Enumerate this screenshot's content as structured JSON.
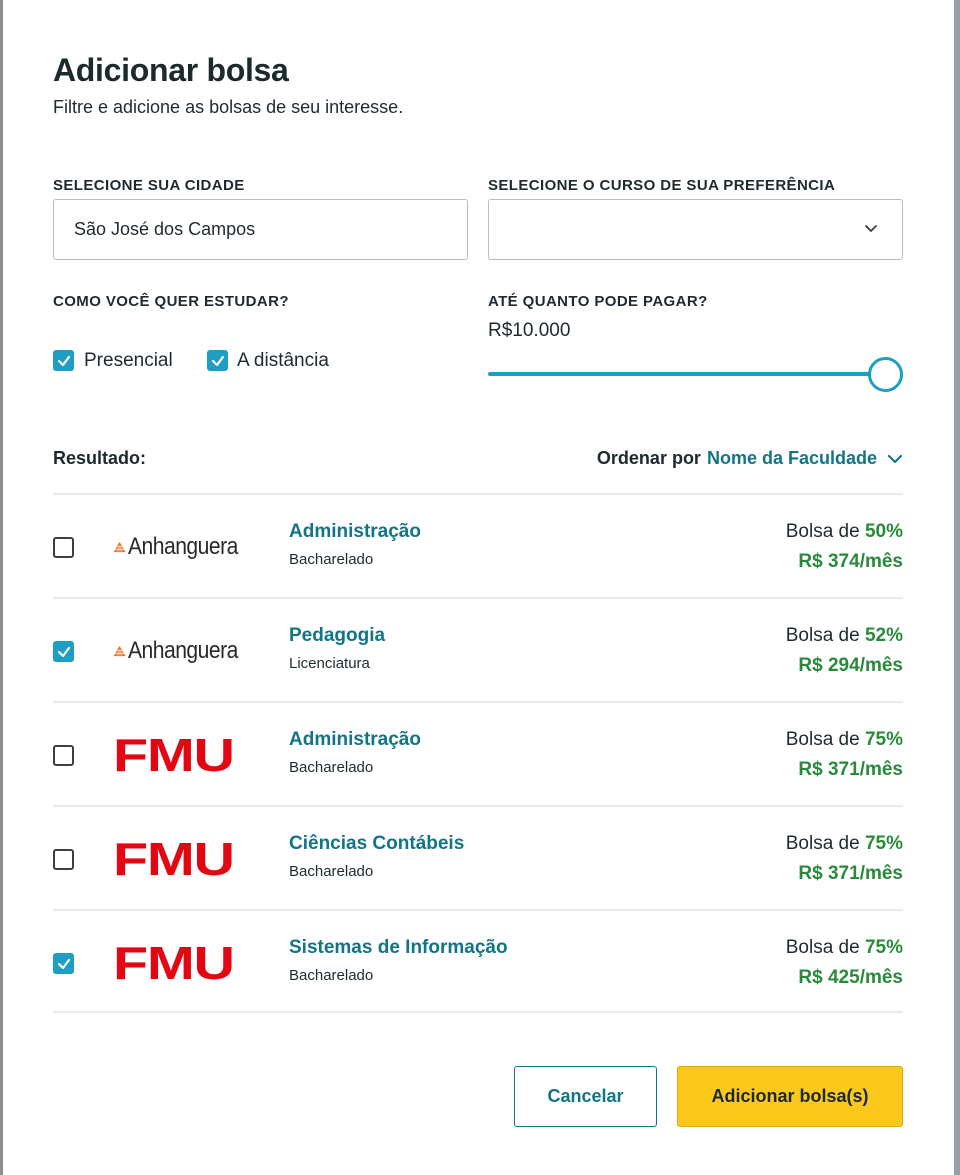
{
  "dialog": {
    "title": "Adicionar bolsa",
    "subtitle": "Filtre e adicione as bolsas de seu interesse."
  },
  "filters": {
    "city_label": "SELECIONE SUA CIDADE",
    "city_value": "São José dos Campos",
    "course_label": "SELECIONE O CURSO DE SUA PREFERÊNCIA",
    "course_value": "",
    "study_label": "COMO VOCÊ QUER ESTUDAR?",
    "study_options": [
      {
        "label": "Presencial",
        "checked": true
      },
      {
        "label": "A distância",
        "checked": true
      }
    ],
    "pay_label": "ATÉ QUANTO PODE PAGAR?",
    "pay_value": "R$10.000",
    "pay_slider_level": 1.0
  },
  "results_header": {
    "label": "Resultado:",
    "sort_prefix": "Ordenar por",
    "sort_value": "Nome da Faculdade"
  },
  "results": [
    {
      "checked": false,
      "institution": "Anhanguera",
      "course": "Administração",
      "degree": "Bacharelado",
      "bolsa_prefix": "Bolsa de",
      "bolsa_pct": "50%",
      "price": "R$ 374/mês"
    },
    {
      "checked": true,
      "institution": "Anhanguera",
      "course": "Pedagogia",
      "degree": "Licenciatura",
      "bolsa_prefix": "Bolsa de",
      "bolsa_pct": "52%",
      "price": "R$ 294/mês"
    },
    {
      "checked": false,
      "institution": "FMU",
      "course": "Administração",
      "degree": "Bacharelado",
      "bolsa_prefix": "Bolsa de",
      "bolsa_pct": "75%",
      "price": "R$ 371/mês"
    },
    {
      "checked": false,
      "institution": "FMU",
      "course": "Ciências Contábeis",
      "degree": "Bacharelado",
      "bolsa_prefix": "Bolsa de",
      "bolsa_pct": "75%",
      "price": "R$ 371/mês"
    },
    {
      "checked": true,
      "institution": "FMU",
      "course": "Sistemas de Informação",
      "degree": "Bacharelado",
      "bolsa_prefix": "Bolsa de",
      "bolsa_pct": "75%",
      "price": "R$ 425/mês"
    }
  ],
  "actions": {
    "cancel_label": "Cancelar",
    "add_label": "Adicionar bolsa(s)"
  },
  "colors": {
    "accent": "#1f9ec4",
    "link": "#117587",
    "success": "#2a8a3a",
    "primary_button": "#fdc81c",
    "fmu_red": "#e30613",
    "anhanguera_orange": "#f26b21"
  }
}
